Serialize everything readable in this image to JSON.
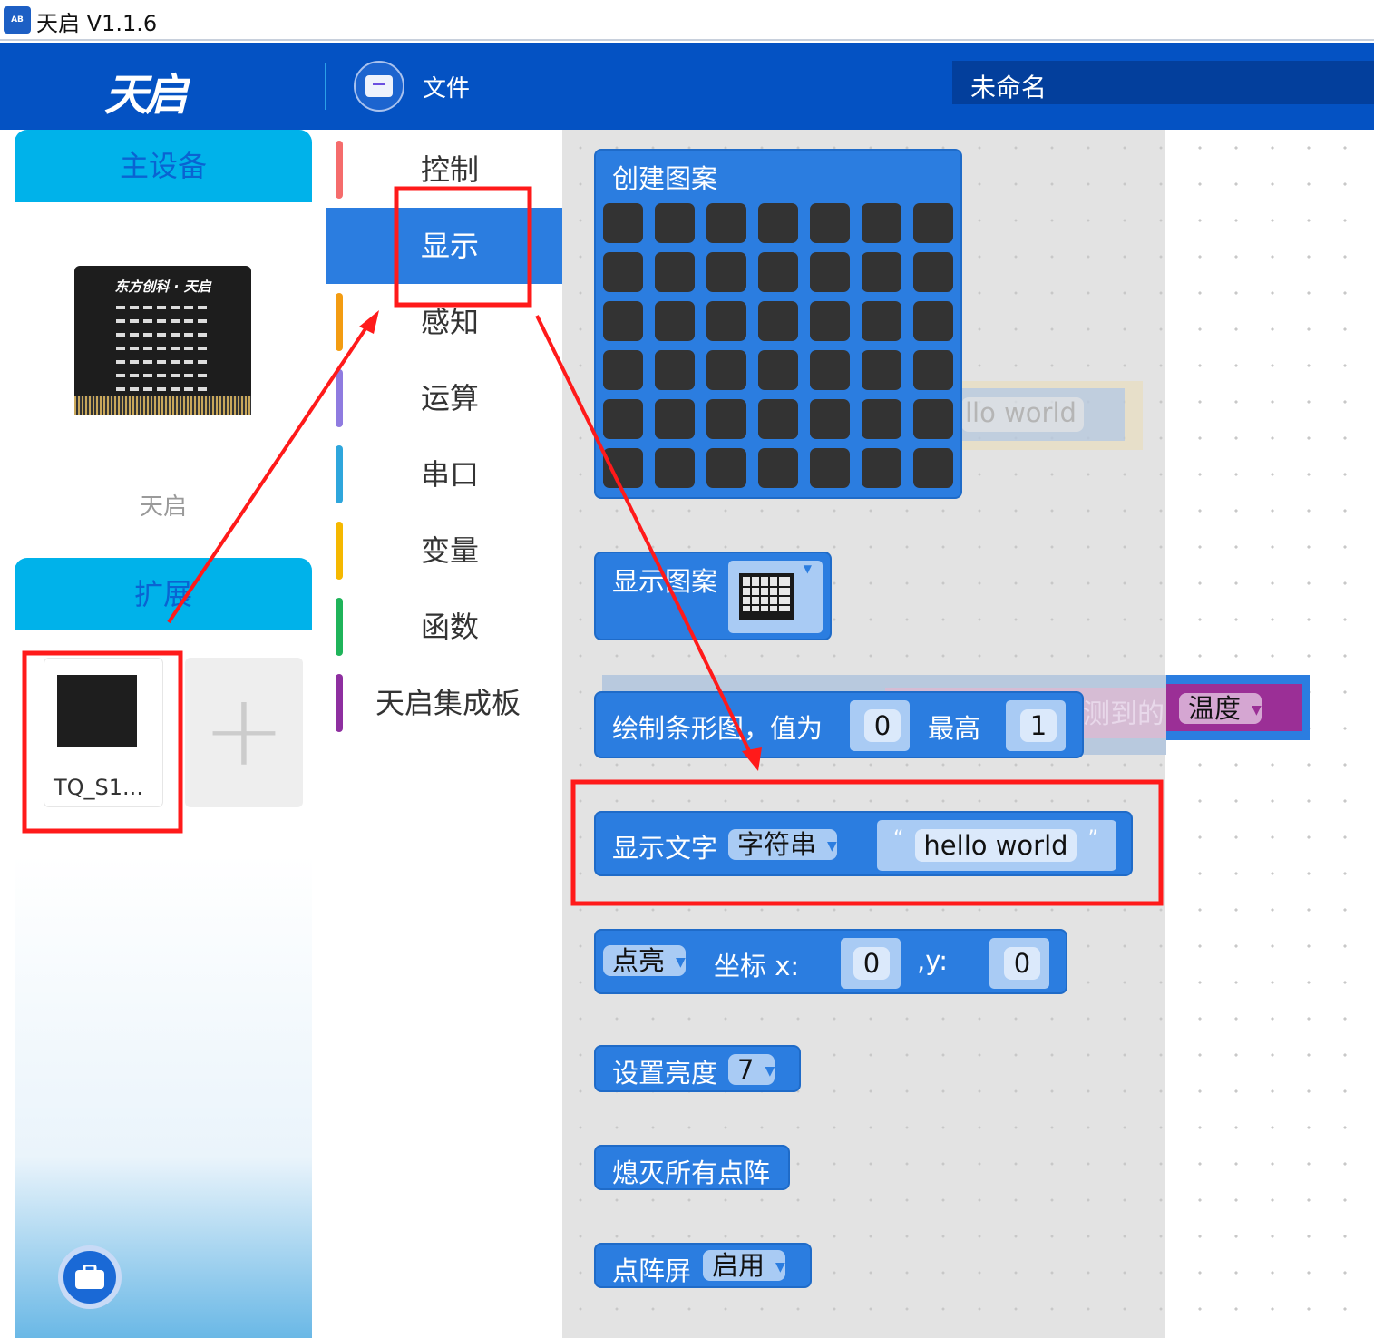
{
  "window": {
    "title": "天启 V1.1.6",
    "app_icon": "AB"
  },
  "header": {
    "logo": "天启",
    "file_label": "文件",
    "project_name": "未命名"
  },
  "left_panel": {
    "main_device_header": "主设备",
    "board_brand": "东方创科 · 天启",
    "device_name": "天启",
    "extension_header": "扩展",
    "extension_card_name": "TQ_S1...",
    "add_extension_icon": "plus-icon"
  },
  "categories": [
    {
      "label": "控制",
      "color": "#f56c6c",
      "selected": false
    },
    {
      "label": "显示",
      "color": "#2b7de0",
      "selected": true
    },
    {
      "label": "感知",
      "color": "#f39c12",
      "selected": false
    },
    {
      "label": "运算",
      "color": "#8f7be0",
      "selected": false
    },
    {
      "label": "串口",
      "color": "#2ea6dc",
      "selected": false
    },
    {
      "label": "变量",
      "color": "#f5b800",
      "selected": false
    },
    {
      "label": "函数",
      "color": "#1fb45a",
      "selected": false
    },
    {
      "label": "天启集成板",
      "color": "#8e2fa0",
      "selected": false
    }
  ],
  "blocks": {
    "create_pattern": {
      "label": "创建图案",
      "rows": 6,
      "cols": 7
    },
    "show_pattern": {
      "label": "显示图案"
    },
    "bar_graph": {
      "label": "绘制条形图，值为",
      "value": "0",
      "max_label": "最高",
      "max": "1"
    },
    "show_text": {
      "label": "显示文字",
      "type": "字符串",
      "text": "hello world",
      "quote_open": "“",
      "quote_close": "”"
    },
    "plot": {
      "action": "点亮",
      "coord_label": "坐标 x:",
      "x": "0",
      "y_label": ",y:",
      "y": "0"
    },
    "brightness": {
      "label": "设置亮度",
      "value": "7"
    },
    "clear": {
      "label": "熄灭所有点阵"
    },
    "matrix": {
      "label": "点阵屏",
      "state": "启用"
    }
  },
  "workspace_ghost": {
    "text_fragment": "llo world",
    "sensor_fragment": "测到的",
    "sensor_value": "温度"
  },
  "colors": {
    "header": "#0452c3",
    "block": "#2b7de0",
    "annotation": "#ff1a1a",
    "sidebar_header": "#00b2ea"
  }
}
